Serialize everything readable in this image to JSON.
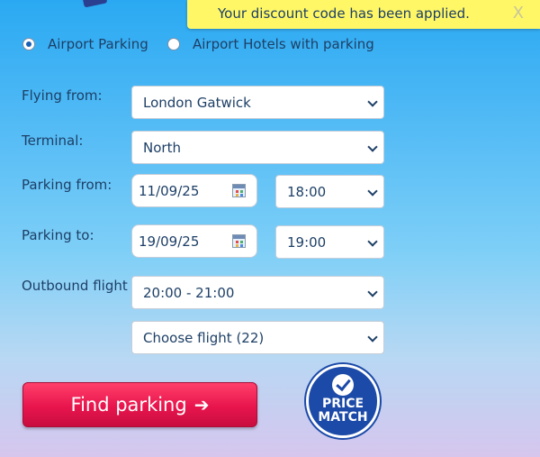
{
  "notification": {
    "message": "Your discount code has been applied.",
    "close_label": "X"
  },
  "search_type": {
    "options": [
      {
        "label": "Airport Parking",
        "checked": true
      },
      {
        "label": "Airport Hotels with parking",
        "checked": false
      }
    ]
  },
  "form": {
    "flying_from_label": "Flying from:",
    "flying_from_value": "London Gatwick",
    "terminal_label": "Terminal:",
    "terminal_value": "North",
    "parking_from_label": "Parking from:",
    "parking_from_date": "11/09/25",
    "parking_from_time": "18:00",
    "parking_to_label": "Parking to:",
    "parking_to_date": "19/09/25",
    "parking_to_time": "19:00",
    "outbound_flight_label": "Outbound flight",
    "outbound_flight_window": "20:00 - 21:00",
    "flight_choice": "Choose flight (22)"
  },
  "actions": {
    "find_label": "Find parking",
    "find_icon": "arrow-right-icon"
  },
  "badge": {
    "line1": "PRICE",
    "line2": "MATCH"
  },
  "colors": {
    "toast_bg": "#fff766",
    "find_button": "#e8154d",
    "badge": "#1c4aa8",
    "text": "#1d3f66"
  }
}
